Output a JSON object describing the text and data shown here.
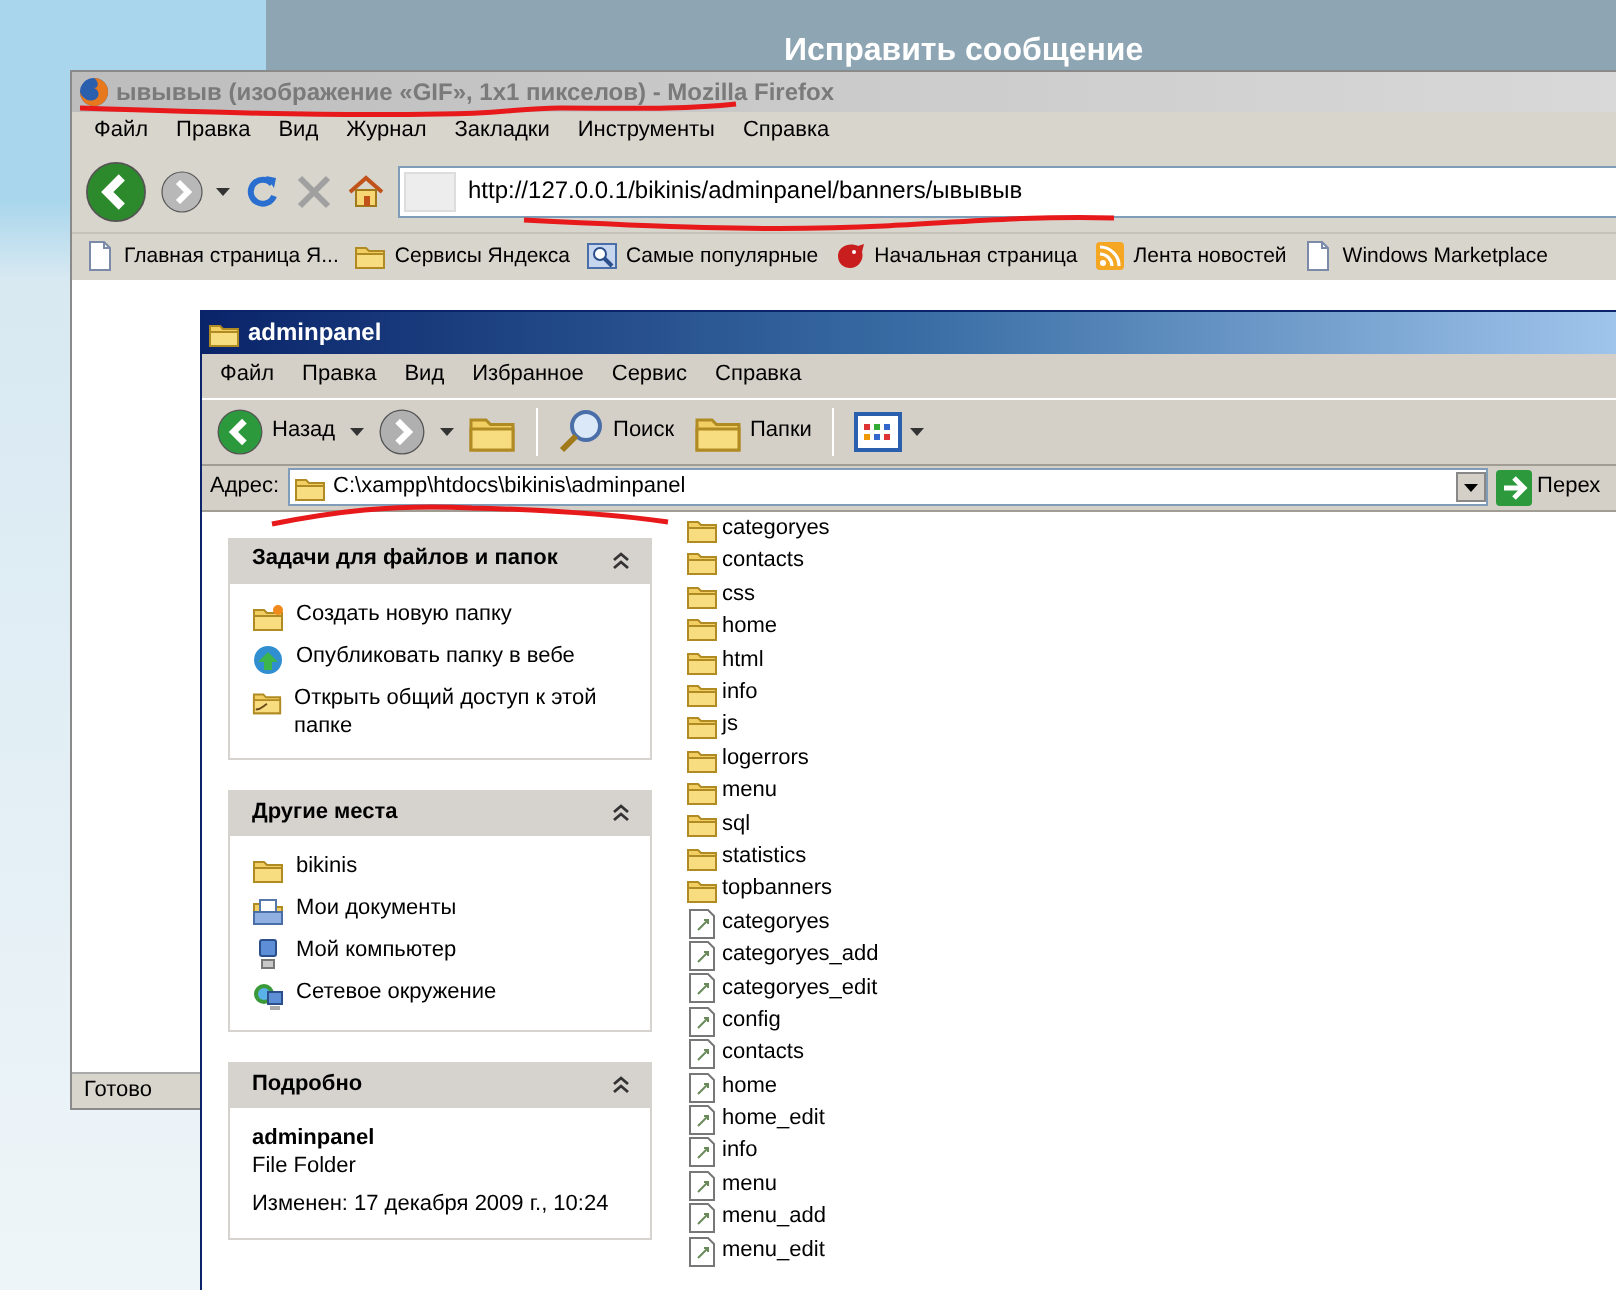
{
  "background_page": {
    "heading": "Исправить сообщение"
  },
  "firefox": {
    "title": "ывывыв (изображение «GIF», 1x1 пикселов) - Mozilla Firefox",
    "menu": [
      "Файл",
      "Правка",
      "Вид",
      "Журнал",
      "Закладки",
      "Инструменты",
      "Справка"
    ],
    "address": "http://127.0.0.1/bikinis/adminpanel/banners/ывывыв",
    "bookmarks": [
      {
        "label": "Главная страница Я...",
        "kind": "page"
      },
      {
        "label": "Сервисы Яндекса",
        "kind": "folder"
      },
      {
        "label": "Самые популярные",
        "kind": "search"
      },
      {
        "label": "Начальная страница",
        "kind": "creature"
      },
      {
        "label": "Лента новостей",
        "kind": "rss"
      },
      {
        "label": "Windows Marketplace",
        "kind": "page"
      }
    ],
    "status": "Готово"
  },
  "explorer": {
    "title": "adminpanel",
    "menu": [
      "Файл",
      "Правка",
      "Вид",
      "Избранное",
      "Сервис",
      "Справка"
    ],
    "toolbar": [
      {
        "kind": "back",
        "label": "Назад"
      },
      {
        "kind": "forward"
      },
      {
        "kind": "up"
      },
      {
        "kind": "search",
        "label": "Поиск"
      },
      {
        "kind": "folders",
        "label": "Папки"
      },
      {
        "kind": "views"
      }
    ],
    "address_label": "Адрес:",
    "address": "C:\\xampp\\htdocs\\bikinis\\adminpanel",
    "go_label": "Перех",
    "panels": [
      {
        "title": "Задачи для файлов и папок",
        "expanded": true,
        "items": [
          {
            "label": "Создать новую папку",
            "kind": "newfolder"
          },
          {
            "label": "Опубликовать папку в вебе",
            "kind": "publish"
          },
          {
            "label": "Открыть общий доступ к этой папке",
            "kind": "share"
          }
        ]
      },
      {
        "title": "Другие места",
        "expanded": true,
        "items": [
          {
            "label": "bikinis",
            "kind": "folder"
          },
          {
            "label": "Мои документы",
            "kind": "documents"
          },
          {
            "label": "Мой компьютер",
            "kind": "computer"
          },
          {
            "label": "Сетевое окружение",
            "kind": "network"
          }
        ]
      },
      {
        "title": "Подробно",
        "expanded": true,
        "details": {
          "name": "adminpanel",
          "type": "File Folder",
          "modified": "Изменен: 17 декабря 2009 г., 10:24"
        }
      }
    ],
    "files": [
      {
        "name": "categoryes",
        "kind": "folder"
      },
      {
        "name": "contacts",
        "kind": "folder"
      },
      {
        "name": "css",
        "kind": "folder"
      },
      {
        "name": "home",
        "kind": "folder"
      },
      {
        "name": "html",
        "kind": "folder"
      },
      {
        "name": "info",
        "kind": "folder"
      },
      {
        "name": "js",
        "kind": "folder"
      },
      {
        "name": "logerrors",
        "kind": "folder"
      },
      {
        "name": "menu",
        "kind": "folder"
      },
      {
        "name": "sql",
        "kind": "folder"
      },
      {
        "name": "statistics",
        "kind": "folder"
      },
      {
        "name": "topbanners",
        "kind": "folder"
      },
      {
        "name": "categoryes",
        "kind": "file"
      },
      {
        "name": "categoryes_add",
        "kind": "file"
      },
      {
        "name": "categoryes_edit",
        "kind": "file"
      },
      {
        "name": "config",
        "kind": "file"
      },
      {
        "name": "contacts",
        "kind": "file"
      },
      {
        "name": "home",
        "kind": "file"
      },
      {
        "name": "home_edit",
        "kind": "file"
      },
      {
        "name": "info",
        "kind": "file"
      },
      {
        "name": "menu",
        "kind": "file"
      },
      {
        "name": "menu_add",
        "kind": "file"
      },
      {
        "name": "menu_edit",
        "kind": "file"
      }
    ]
  }
}
